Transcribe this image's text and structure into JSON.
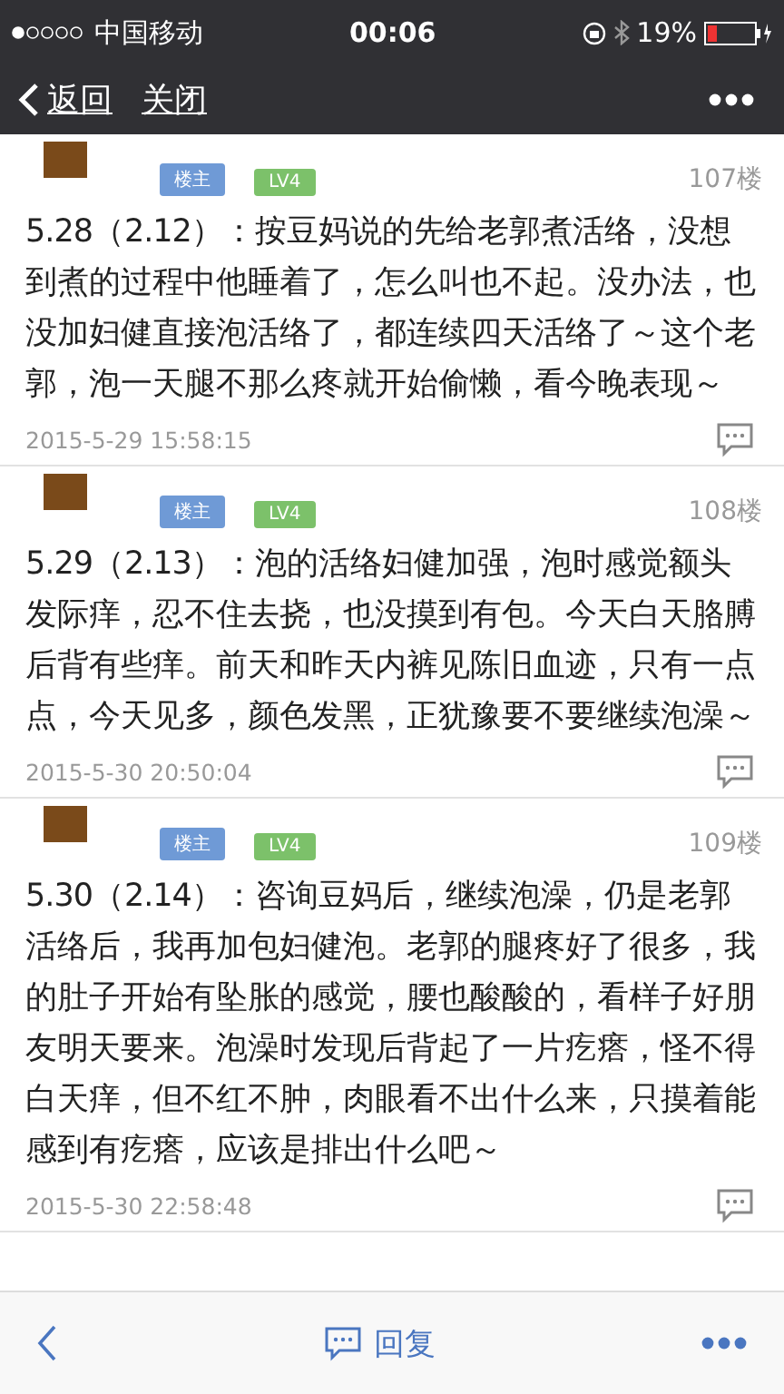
{
  "status_bar": {
    "carrier": "中国移动",
    "time": "00:06",
    "battery": "19%"
  },
  "nav": {
    "back": "返回",
    "close": "关闭"
  },
  "posts": [
    {
      "badges": [
        {
          "label": "楼主",
          "kind": "owner"
        },
        {
          "label": "LV4",
          "kind": "level"
        }
      ],
      "floor": "107楼",
      "text": "5.28（2.12）：按豆妈说的先给老郭煮活络，没想到煮的过程中他睡着了，怎么叫也不起。没办法，也没加妇健直接泡活络了，都连续四天活络了～这个老郭，泡一天腿不那么疼就开始偷懒，看今晚表现～",
      "time": "2015-5-29 15:58:15"
    },
    {
      "badges": [
        {
          "label": "楼主",
          "kind": "owner"
        },
        {
          "label": "LV4",
          "kind": "level"
        }
      ],
      "floor": "108楼",
      "text": "5.29（2.13）：泡的活络妇健加强，泡时感觉额头发际痒，忍不住去挠，也没摸到有包。今天白天胳膊后背有些痒。前天和昨天内裤见陈旧血迹，只有一点点，今天见多，颜色发黑，正犹豫要不要继续泡澡～",
      "time": "2015-5-30 20:50:04"
    },
    {
      "badges": [
        {
          "label": "楼主",
          "kind": "owner"
        },
        {
          "label": "LV4",
          "kind": "level"
        }
      ],
      "floor": "109楼",
      "text": "5.30（2.14）：咨询豆妈后，继续泡澡，仍是老郭活络后，我再加包妇健泡。老郭的腿疼好了很多，我的肚子开始有坠胀的感觉，腰也酸酸的，看样子好朋友明天要来。泡澡时发现后背起了一片疙瘩，怪不得白天痒，但不红不肿，肉眼看不出什么来，只摸着能感到有疙瘩，应该是排出什么吧～",
      "time": "2015-5-30 22:58:48"
    }
  ],
  "bottom_bar": {
    "reply": "回复"
  }
}
